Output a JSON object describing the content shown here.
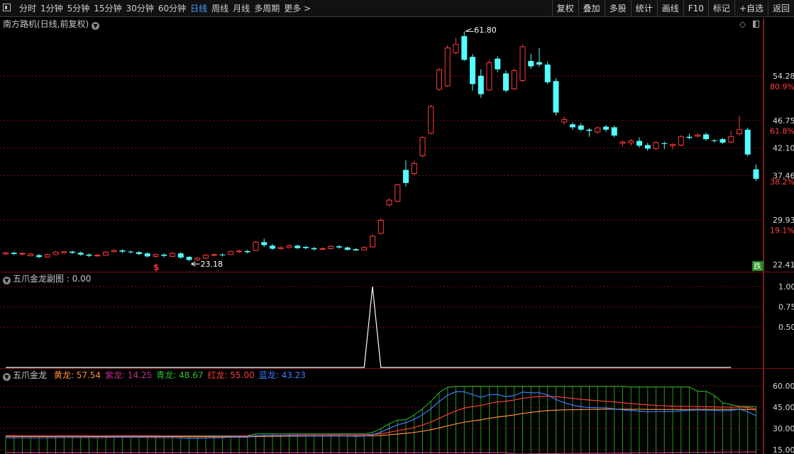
{
  "toolbar": {
    "periods": [
      "分时",
      "1分钟",
      "5分钟",
      "15分钟",
      "30分钟",
      "60分钟",
      "日线",
      "周线",
      "月线",
      "多周期",
      "更多 >"
    ],
    "active_period": "日线",
    "tools": [
      "复权",
      "叠加",
      "多股",
      "统计",
      "画线",
      "F10",
      "标记",
      "+自选",
      "返回"
    ]
  },
  "main_panel": {
    "title": "南方路机(日线,前复权)",
    "axis_labels": [
      {
        "price": 54.28,
        "text": "54.28"
      },
      {
        "price": 46.75,
        "text": "46.75"
      },
      {
        "price": 42.1,
        "text": "42.10"
      },
      {
        "price": 37.46,
        "text": "37.46"
      },
      {
        "price": 29.93,
        "text": "29.93"
      },
      {
        "price": 22.41,
        "text": "22.41"
      }
    ],
    "pct_labels": [
      {
        "price": 52.5,
        "text": "80.9%"
      },
      {
        "price": 45.0,
        "text": "61.8%"
      },
      {
        "price": 36.4,
        "text": "38.2%"
      },
      {
        "price": 28.2,
        "text": "19.1%"
      }
    ],
    "high_label": "61.80",
    "low_label": "23.18",
    "signal_mark": "$",
    "fall_badge": "跌",
    "colors": {
      "up": "#ff3c3c",
      "down": "#54ffff",
      "grid": "#7a1010",
      "axis": "#ff4040"
    }
  },
  "sub1": {
    "title": "五爪金龙副图 : 0.00",
    "axis_labels": [
      "1.00",
      "0.75",
      "0.50"
    ],
    "values": [
      0,
      0,
      0,
      0,
      0,
      0,
      0,
      0,
      0,
      0,
      0,
      0,
      0,
      0,
      0,
      0,
      0,
      0,
      0,
      0,
      0,
      0,
      0,
      0,
      0,
      0,
      0,
      0,
      0,
      0,
      0,
      0,
      0,
      0,
      0,
      0,
      0,
      0,
      0,
      0,
      0,
      0,
      0,
      0,
      1,
      0,
      0,
      0,
      0,
      0,
      0,
      0,
      0,
      0,
      0,
      0,
      0,
      0,
      0,
      0,
      0,
      0,
      0,
      0,
      0,
      0,
      0,
      0,
      0,
      0,
      0,
      0,
      0,
      0,
      0,
      0,
      0,
      0,
      0,
      0,
      0,
      0,
      0,
      0,
      0,
      0,
      0,
      0
    ]
  },
  "sub2": {
    "title": "五爪金龙",
    "legend": [
      {
        "name": "黄龙:",
        "value": "57.54",
        "color": "#ff8c40"
      },
      {
        "name": "紫龙:",
        "value": "14.25",
        "color": "#c0308a"
      },
      {
        "name": "青龙:",
        "value": "48.67",
        "color": "#2fbf2f"
      },
      {
        "name": "红龙:",
        "value": "55.00",
        "color": "#ff3c3c"
      },
      {
        "name": "蓝龙:",
        "value": "43.23",
        "color": "#3a7bff"
      }
    ],
    "axis_labels": [
      "60.00",
      "45.00",
      "30.00",
      "15.00"
    ]
  },
  "chart_data": {
    "type": "candlestick",
    "candles": [
      [
        24.2,
        24.4,
        24.6,
        24.0
      ],
      [
        24.4,
        24.2,
        24.6,
        24.0
      ],
      [
        24.2,
        24.3,
        24.5,
        24.0
      ],
      [
        23.9,
        24.2,
        24.4,
        23.8
      ],
      [
        24.0,
        23.7,
        24.2,
        23.5
      ],
      [
        23.7,
        24.1,
        24.3,
        23.6
      ],
      [
        24.1,
        24.5,
        24.7,
        24.0
      ],
      [
        24.4,
        24.6,
        24.8,
        24.2
      ],
      [
        24.6,
        24.4,
        24.8,
        24.2
      ],
      [
        24.4,
        24.1,
        24.6,
        23.9
      ],
      [
        24.1,
        23.9,
        24.3,
        23.7
      ],
      [
        23.9,
        24.0,
        24.2,
        23.7
      ],
      [
        24.0,
        24.5,
        24.7,
        23.9
      ],
      [
        24.6,
        24.8,
        25.0,
        24.4
      ],
      [
        24.8,
        24.6,
        25.0,
        24.4
      ],
      [
        24.6,
        24.5,
        24.8,
        24.3
      ],
      [
        24.5,
        24.2,
        24.7,
        24.0
      ],
      [
        24.3,
        23.8,
        24.5,
        23.6
      ],
      [
        23.8,
        24.1,
        24.3,
        23.6
      ],
      [
        24.1,
        23.9,
        24.3,
        23.6
      ],
      [
        23.8,
        24.3,
        24.6,
        23.7
      ],
      [
        24.3,
        23.6,
        24.5,
        23.4
      ],
      [
        23.7,
        23.2,
        23.9,
        23.0
      ],
      [
        23.2,
        23.5,
        23.7,
        23.0
      ],
      [
        23.5,
        24.0,
        24.2,
        23.3
      ],
      [
        24.0,
        24.1,
        24.3,
        23.8
      ],
      [
        24.1,
        24.0,
        24.3,
        23.8
      ],
      [
        24.1,
        24.6,
        24.8,
        24.0
      ],
      [
        24.6,
        24.7,
        24.9,
        24.4
      ],
      [
        24.7,
        24.5,
        24.9,
        24.3
      ],
      [
        24.8,
        26.2,
        26.4,
        24.7
      ],
      [
        26.2,
        25.7,
        26.8,
        25.4
      ],
      [
        25.6,
        25.1,
        25.9,
        24.9
      ],
      [
        25.1,
        25.3,
        25.5,
        24.9
      ],
      [
        25.3,
        25.6,
        25.8,
        25.1
      ],
      [
        25.6,
        25.2,
        25.8,
        25.0
      ],
      [
        25.4,
        25.2,
        25.6,
        25.0
      ],
      [
        25.2,
        25.0,
        25.4,
        24.8
      ],
      [
        25.0,
        25.1,
        25.3,
        24.9
      ],
      [
        25.1,
        25.5,
        25.7,
        25.0
      ],
      [
        25.5,
        25.3,
        25.7,
        25.1
      ],
      [
        25.3,
        24.9,
        25.5,
        24.8
      ],
      [
        25.0,
        24.8,
        25.2,
        24.7
      ],
      [
        24.9,
        25.3,
        25.5,
        24.8
      ],
      [
        25.4,
        27.2,
        27.5,
        25.3
      ],
      [
        27.7,
        29.9,
        30.2,
        27.5
      ],
      [
        32.5,
        33.3,
        33.6,
        32.2
      ],
      [
        33.1,
        35.9,
        36.1,
        32.9
      ],
      [
        38.4,
        36.2,
        40.0,
        35.6
      ],
      [
        37.8,
        39.5,
        40.0,
        37.5
      ],
      [
        40.8,
        43.9,
        44.1,
        40.5
      ],
      [
        44.6,
        49.1,
        49.4,
        44.4
      ],
      [
        52.0,
        55.3,
        55.6,
        51.8
      ],
      [
        52.6,
        59.0,
        59.5,
        52.4
      ],
      [
        58.2,
        59.6,
        60.7,
        57.9
      ],
      [
        61.0,
        57.0,
        61.8,
        56.8
      ],
      [
        57.5,
        52.9,
        58.0,
        51.8
      ],
      [
        54.3,
        51.2,
        55.4,
        50.6
      ],
      [
        51.9,
        56.5,
        57.0,
        51.7
      ],
      [
        57.2,
        55.4,
        57.6,
        54.9
      ],
      [
        54.7,
        51.8,
        55.2,
        51.5
      ],
      [
        52.1,
        55.2,
        55.5,
        51.9
      ],
      [
        53.5,
        59.2,
        59.6,
        53.2
      ],
      [
        56.8,
        55.9,
        58.0,
        55.5
      ],
      [
        56.6,
        56.2,
        59.0,
        55.8
      ],
      [
        56.2,
        53.2,
        56.7,
        52.9
      ],
      [
        53.4,
        48.1,
        53.9,
        47.6
      ],
      [
        46.5,
        46.9,
        47.4,
        46.0
      ],
      [
        46.1,
        45.6,
        46.4,
        45.2
      ],
      [
        45.9,
        45.2,
        46.3,
        44.9
      ],
      [
        45.2,
        45.0,
        45.5,
        44.0
      ],
      [
        44.8,
        45.5,
        45.8,
        44.5
      ],
      [
        45.7,
        45.2,
        46.0,
        44.8
      ],
      [
        45.6,
        44.2,
        45.9,
        43.9
      ],
      [
        42.9,
        43.1,
        43.4,
        42.4
      ],
      [
        43.0,
        43.3,
        43.6,
        42.5
      ],
      [
        43.3,
        42.5,
        43.9,
        42.2
      ],
      [
        42.6,
        42.0,
        43.0,
        41.6
      ],
      [
        42.0,
        43.0,
        43.3,
        41.8
      ],
      [
        42.9,
        42.8,
        43.2,
        41.9
      ],
      [
        42.5,
        42.7,
        42.9,
        41.9
      ],
      [
        42.6,
        44.0,
        44.3,
        42.4
      ],
      [
        44.0,
        43.8,
        44.5,
        43.6
      ],
      [
        44.1,
        44.3,
        44.6,
        43.9
      ],
      [
        44.4,
        43.6,
        44.7,
        43.3
      ],
      [
        43.4,
        43.3,
        43.6,
        43.0
      ],
      [
        43.6,
        43.0,
        43.8,
        42.8
      ],
      [
        43.1,
        44.0,
        45.0,
        42.9
      ],
      [
        44.5,
        45.2,
        47.6,
        44.2
      ],
      [
        45.2,
        41.0,
        45.5,
        40.7
      ],
      [
        38.5,
        36.9,
        39.3,
        36.5
      ]
    ]
  }
}
